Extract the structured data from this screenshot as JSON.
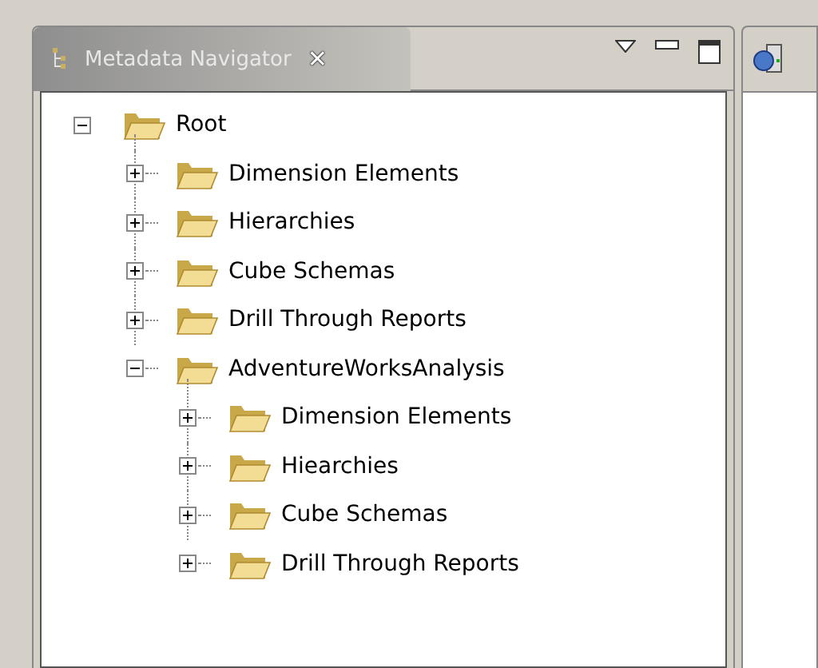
{
  "view": {
    "title": "Metadata Navigator",
    "close": "✕"
  },
  "tree": [
    {
      "label": "Root",
      "expanded": true,
      "children": [
        {
          "label": "Dimension Elements",
          "expanded": false
        },
        {
          "label": "Hierarchies",
          "expanded": false
        },
        {
          "label": "Cube Schemas",
          "expanded": false
        },
        {
          "label": "Drill Through Reports",
          "expanded": false
        },
        {
          "label": "AdventureWorksAnalysis",
          "expanded": true,
          "children": [
            {
              "label": "Dimension Elements",
              "expanded": false
            },
            {
              "label": "Hiearchies",
              "expanded": false
            },
            {
              "label": "Cube Schemas",
              "expanded": false
            },
            {
              "label": "Drill Through Reports",
              "expanded": false
            }
          ]
        }
      ]
    }
  ]
}
